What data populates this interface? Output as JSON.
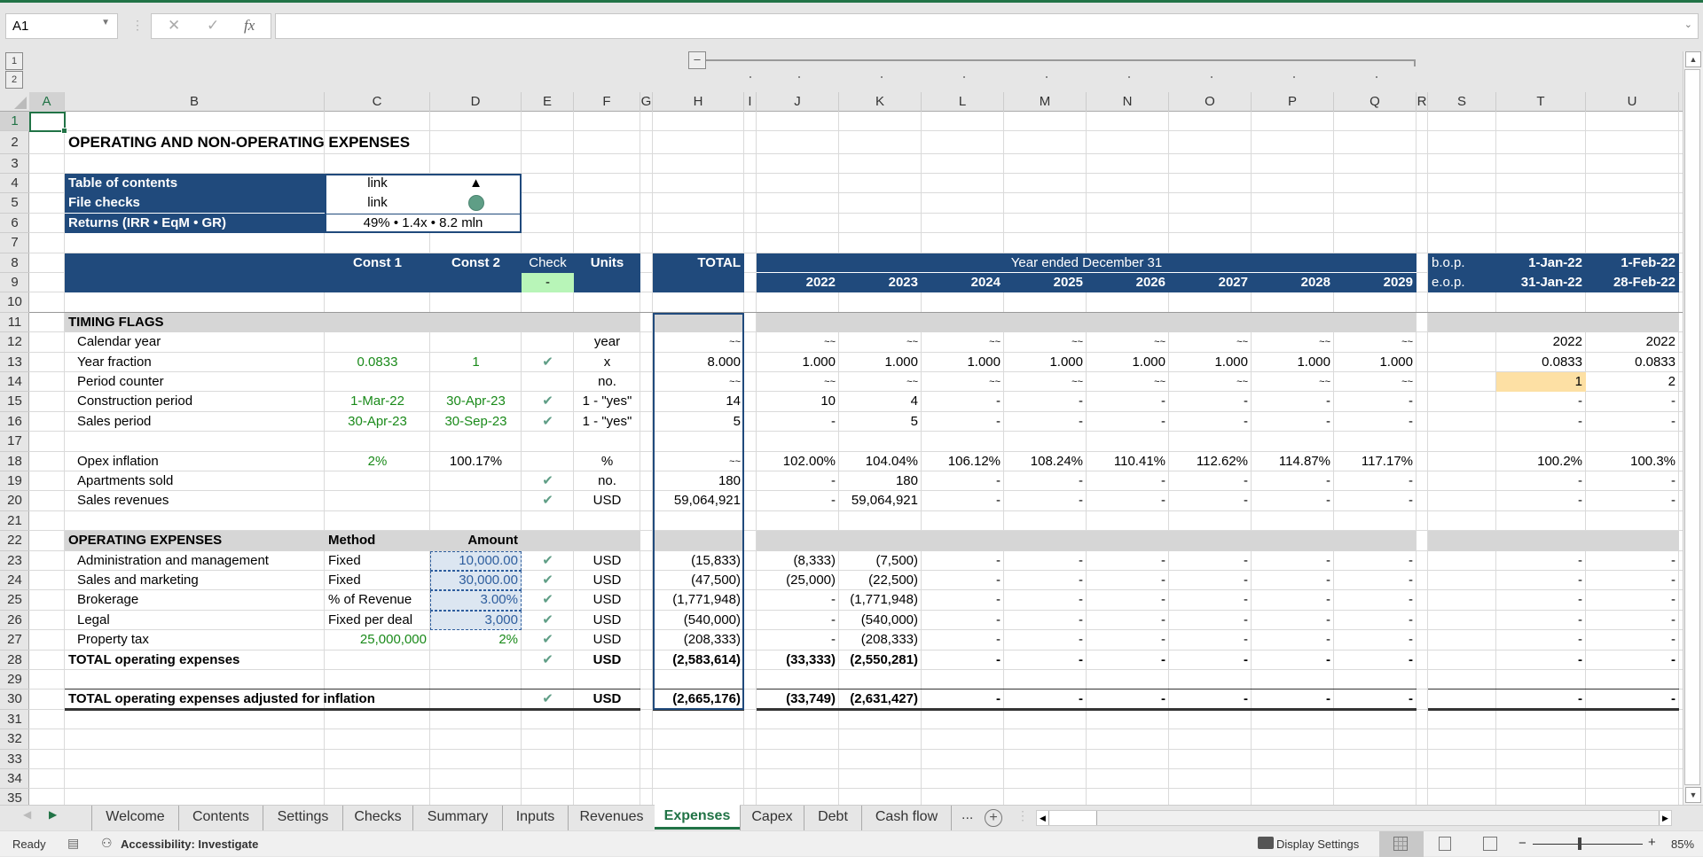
{
  "formula_bar": {
    "name_box": "A1",
    "cancel_icon": "✕",
    "enter_icon": "✓",
    "fx_label": "fx",
    "formula": ""
  },
  "outline": {
    "levels": [
      "1",
      "2"
    ],
    "collapse_label": "–"
  },
  "columns": [
    "A",
    "B",
    "C",
    "D",
    "E",
    "F",
    "G",
    "H",
    "I",
    "J",
    "K",
    "L",
    "M",
    "N",
    "O",
    "P",
    "Q",
    "R",
    "S",
    "T",
    "U"
  ],
  "rows": [
    "1",
    "2",
    "3",
    "4",
    "5",
    "6",
    "7",
    "8",
    "9",
    "10",
    "11",
    "12",
    "13",
    "14",
    "15",
    "16",
    "17",
    "18",
    "19",
    "20",
    "21",
    "22",
    "23",
    "24",
    "25",
    "26",
    "27",
    "28",
    "29",
    "30",
    "31",
    "32",
    "33",
    "34",
    "35"
  ],
  "sheet": {
    "title": "OPERATING AND NON-OPERATING EXPENSES",
    "nav": {
      "toc_label": "Table of contents",
      "toc_link": "link",
      "toc_icon": "▲",
      "checks_label": "File checks",
      "checks_link": "link",
      "returns_label": "Returns (IRR • EqM • GR)",
      "returns_value": "49% • 1.4x • 8.2 mln"
    },
    "header": {
      "const1": "Const 1",
      "const2": "Const 2",
      "check": "Check",
      "units": "Units",
      "check_value": "-",
      "total": "TOTAL",
      "year_band": "Year ended December 31",
      "years": [
        "2022",
        "2023",
        "2024",
        "2025",
        "2026",
        "2027",
        "2028",
        "2029"
      ],
      "bop": "b.o.p.",
      "eop": "e.o.p.",
      "monthly": [
        {
          "start": "1-Jan-22",
          "end": "31-Jan-22"
        },
        {
          "start": "1-Feb-22",
          "end": "28-Feb-22"
        }
      ]
    },
    "timing": {
      "section": "TIMING FLAGS",
      "rows": [
        {
          "row": 12,
          "label": "Calendar year",
          "c": "",
          "d": "",
          "check": false,
          "units": "year",
          "total": "~~",
          "years": [
            "~~",
            "~~",
            "~~",
            "~~",
            "~~",
            "~~",
            "~~",
            "~~"
          ],
          "t": "2022",
          "u": "2022"
        },
        {
          "row": 13,
          "label": "Year fraction",
          "c": "0.0833",
          "d": "1",
          "check": true,
          "units": "x",
          "total": "8.000",
          "years": [
            "1.000",
            "1.000",
            "1.000",
            "1.000",
            "1.000",
            "1.000",
            "1.000",
            "1.000"
          ],
          "t": "0.0833",
          "u": "0.0833"
        },
        {
          "row": 14,
          "label": "Period counter",
          "c": "",
          "d": "",
          "check": false,
          "units": "no.",
          "total": "~~",
          "years": [
            "~~",
            "~~",
            "~~",
            "~~",
            "~~",
            "~~",
            "~~",
            "~~"
          ],
          "t": "1",
          "u": "2"
        },
        {
          "row": 15,
          "label": "Construction period",
          "c": "1-Mar-22",
          "d": "30-Apr-23",
          "check": true,
          "units": "1 - \"yes\"",
          "total": "14",
          "years": [
            "10",
            "4",
            "-",
            "-",
            "-",
            "-",
            "-",
            "-"
          ],
          "t": "-",
          "u": "-"
        },
        {
          "row": 16,
          "label": "Sales period",
          "c": "30-Apr-23",
          "d": "30-Sep-23",
          "check": true,
          "units": "1 - \"yes\"",
          "total": "5",
          "years": [
            "-",
            "5",
            "-",
            "-",
            "-",
            "-",
            "-",
            "-"
          ],
          "t": "-",
          "u": "-"
        },
        {
          "row": 18,
          "label": "Opex inflation",
          "c": "2%",
          "d": "100.17%",
          "check": false,
          "units": "%",
          "total": "~~",
          "years": [
            "102.00%",
            "104.04%",
            "106.12%",
            "108.24%",
            "110.41%",
            "112.62%",
            "114.87%",
            "117.17%"
          ],
          "t": "100.2%",
          "u": "100.3%"
        },
        {
          "row": 19,
          "label": "Apartments sold",
          "c": "",
          "d": "",
          "check": true,
          "units": "no.",
          "total": "180",
          "years": [
            "-",
            "180",
            "-",
            "-",
            "-",
            "-",
            "-",
            "-"
          ],
          "t": "-",
          "u": "-"
        },
        {
          "row": 20,
          "label": "Sales revenues",
          "c": "",
          "d": "",
          "check": true,
          "units": "USD",
          "total": "59,064,921",
          "years": [
            "-",
            "59,064,921",
            "-",
            "-",
            "-",
            "-",
            "-",
            "-"
          ],
          "t": "-",
          "u": "-"
        }
      ]
    },
    "opex": {
      "section": "OPERATING EXPENSES",
      "method_header": "Method",
      "amount_header": "Amount",
      "rows": [
        {
          "row": 23,
          "label": "Administration and management",
          "c": "Fixed",
          "d": "10,000.00",
          "check": true,
          "units": "USD",
          "total": "(15,833)",
          "years": [
            "(8,333)",
            "(7,500)",
            "-",
            "-",
            "-",
            "-",
            "-",
            "-"
          ],
          "t": "-",
          "u": "-"
        },
        {
          "row": 24,
          "label": "Sales and marketing",
          "c": "Fixed",
          "d": "30,000.00",
          "check": true,
          "units": "USD",
          "total": "(47,500)",
          "years": [
            "(25,000)",
            "(22,500)",
            "-",
            "-",
            "-",
            "-",
            "-",
            "-"
          ],
          "t": "-",
          "u": "-"
        },
        {
          "row": 25,
          "label": "Brokerage",
          "c": "% of Revenue",
          "d": "3.00%",
          "check": true,
          "units": "USD",
          "total": "(1,771,948)",
          "years": [
            "-",
            "(1,771,948)",
            "-",
            "-",
            "-",
            "-",
            "-",
            "-"
          ],
          "t": "-",
          "u": "-"
        },
        {
          "row": 26,
          "label": "Legal",
          "c": "Fixed per deal",
          "d": "3,000",
          "check": true,
          "units": "USD",
          "total": "(540,000)",
          "years": [
            "-",
            "(540,000)",
            "-",
            "-",
            "-",
            "-",
            "-",
            "-"
          ],
          "t": "-",
          "u": "-"
        },
        {
          "row": 27,
          "label": "Property tax",
          "c": "25,000,000",
          "d": "2%",
          "check": true,
          "units": "USD",
          "total": "(208,333)",
          "years": [
            "-",
            "(208,333)",
            "-",
            "-",
            "-",
            "-",
            "-",
            "-"
          ],
          "t": "-",
          "u": "-"
        }
      ],
      "total": {
        "row": 28,
        "label": "TOTAL operating expenses",
        "check": true,
        "units": "USD",
        "total": "(2,583,614)",
        "years": [
          "(33,333)",
          "(2,550,281)",
          "-",
          "-",
          "-",
          "-",
          "-",
          "-"
        ],
        "t": "-",
        "u": "-"
      },
      "adjusted": {
        "row": 30,
        "label": "TOTAL operating expenses adjusted for inflation",
        "check": true,
        "units": "USD",
        "total": "(2,665,176)",
        "years": [
          "(33,749)",
          "(2,631,427)",
          "-",
          "-",
          "-",
          "-",
          "-",
          "-"
        ],
        "t": "-",
        "u": "-"
      }
    },
    "check_glyph": "✔"
  },
  "tabs": {
    "items": [
      "Welcome",
      "Contents",
      "Settings",
      "Checks",
      "Summary",
      "Inputs",
      "Revenues",
      "Expenses",
      "Capex",
      "Debt",
      "Cash flow"
    ],
    "active": "Expenses",
    "more": "...",
    "add": "+"
  },
  "status": {
    "ready": "Ready",
    "accessibility": "Accessibility: Investigate",
    "display_settings": "Display Settings",
    "zoom_minus": "−",
    "zoom_plus": "+",
    "zoom": "85%"
  },
  "colors": {
    "header_blue": "#204a7c",
    "accent_green": "#217346",
    "check_green": "#5f9e86",
    "input_green": "#1a8a1a",
    "highlight_orange": "#fde0a4",
    "check_cell": "#b8f5b8"
  }
}
